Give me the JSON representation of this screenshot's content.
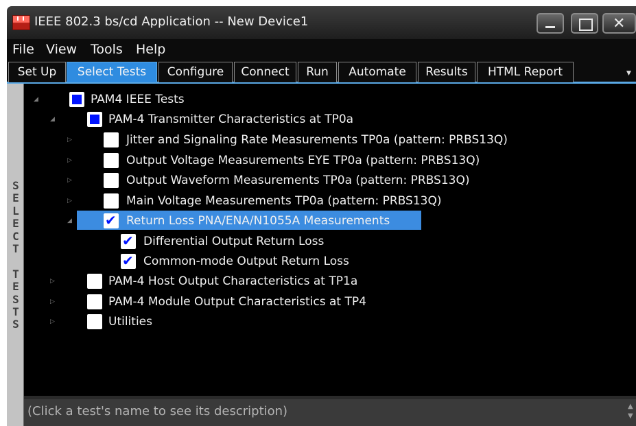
{
  "window": {
    "title": "IEEE 802.3 bs/cd Application -- New Device1"
  },
  "menu": [
    "File",
    "View",
    "Tools",
    "Help"
  ],
  "tabs": [
    "Set Up",
    "Select Tests",
    "Configure",
    "Connect",
    "Run",
    "Automate",
    "Results",
    "HTML Report"
  ],
  "active_tab": "Select Tests",
  "side_label": "SELECT TESTS",
  "tree": {
    "root": "PAM4 IEEE Tests",
    "tx": "PAM-4 Transmitter Characteristics at TP0a",
    "jitter": "Jitter and Signaling Rate Measurements TP0a (pattern: PRBS13Q)",
    "voltage_eye": "Output Voltage Measurements EYE TP0a (pattern: PRBS13Q)",
    "waveform": "Output Waveform Measurements TP0a (pattern: PRBS13Q)",
    "main_voltage": "Main Voltage Measurements TP0a (pattern: PRBS13Q)",
    "return_loss": "Return Loss PNA/ENA/N1055A Measurements",
    "diff_rl": "Differential Output Return Loss",
    "cm_rl": "Common-mode Output Return Loss",
    "host": "PAM-4 Host Output Characteristics at TP1a",
    "module": "PAM-4 Module Output Characteristics at TP4",
    "utilities": "Utilities"
  },
  "description": "(Click a test's name to see its description)",
  "colors": {
    "accent": "#2f8ce0",
    "selection": "#3c8ce0",
    "check": "#0014ff",
    "tree_bg": "#000000"
  }
}
